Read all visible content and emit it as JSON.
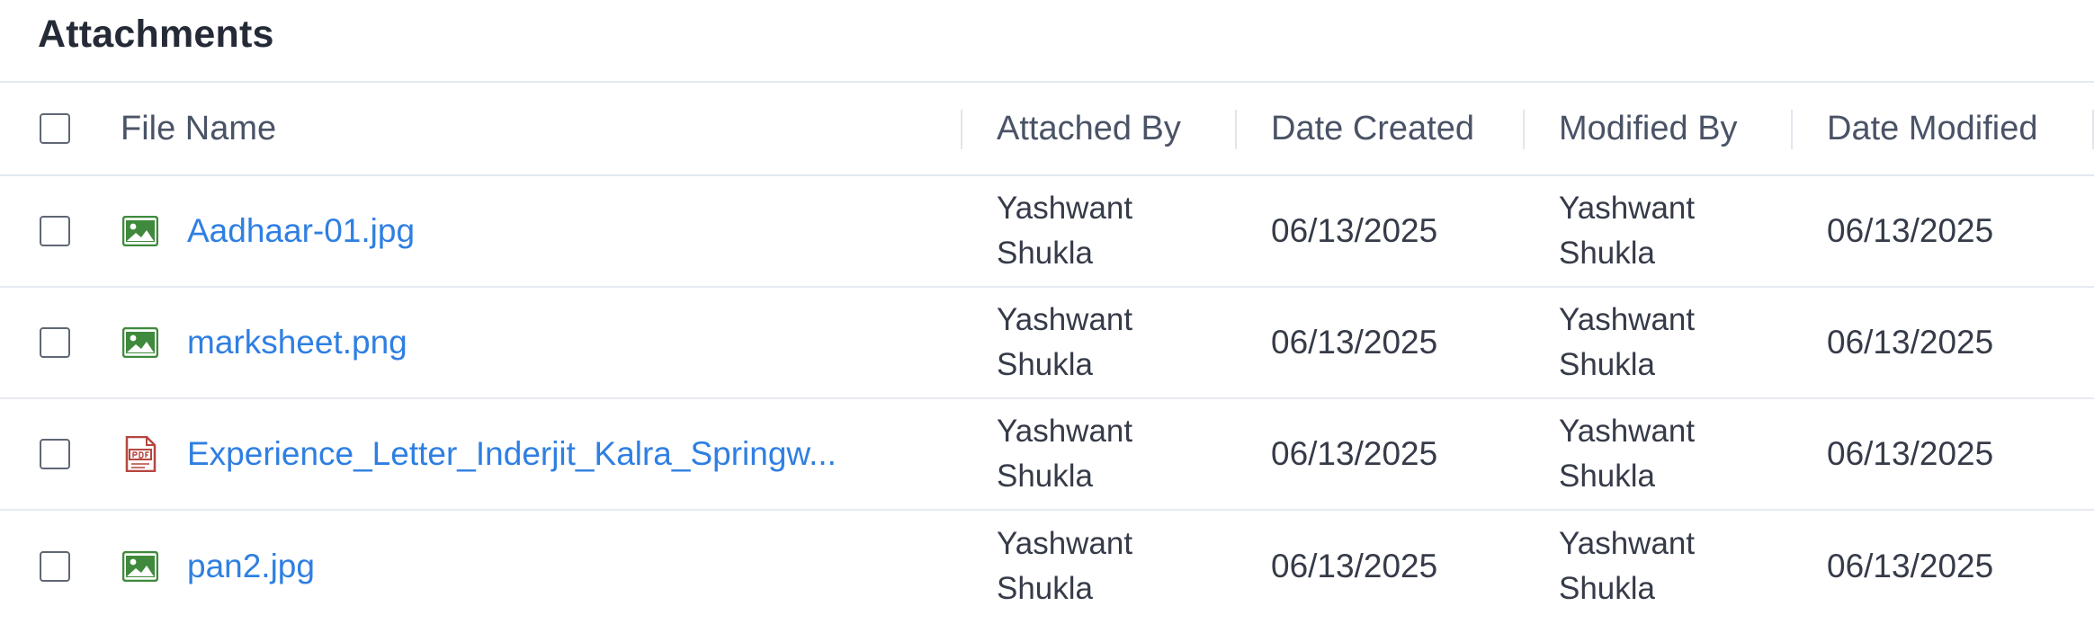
{
  "panel": {
    "title": "Attachments"
  },
  "columns": {
    "file_name": "File Name",
    "attached_by": "Attached By",
    "date_created": "Date Created",
    "modified_by": "Modified By",
    "date_modified": "Date Modified"
  },
  "rows": [
    {
      "icon": "image-file-icon",
      "file_name": "Aadhaar-01.jpg",
      "attached_by_first": "Yashwant",
      "attached_by_last": "Shukla",
      "date_created": "06/13/2025",
      "modified_by_first": "Yashwant",
      "modified_by_last": "Shukla",
      "date_modified": "06/13/2025"
    },
    {
      "icon": "image-file-icon",
      "file_name": "marksheet.png",
      "attached_by_first": "Yashwant",
      "attached_by_last": "Shukla",
      "date_created": "06/13/2025",
      "modified_by_first": "Yashwant",
      "modified_by_last": "Shukla",
      "date_modified": "06/13/2025"
    },
    {
      "icon": "pdf-file-icon",
      "file_name": "Experience_Letter_Inderjit_Kalra_Springw...",
      "attached_by_first": "Yashwant",
      "attached_by_last": "Shukla",
      "date_created": "06/13/2025",
      "modified_by_first": "Yashwant",
      "modified_by_last": "Shukla",
      "date_modified": "06/13/2025"
    },
    {
      "icon": "image-file-icon",
      "file_name": "pan2.jpg",
      "attached_by_first": "Yashwant",
      "attached_by_last": "Shukla",
      "date_created": "06/13/2025",
      "modified_by_first": "Yashwant",
      "modified_by_last": "Shukla",
      "date_modified": "06/13/2025"
    }
  ],
  "colors": {
    "link": "#2f7fe2",
    "image_icon": "#3f8a3c",
    "pdf_icon": "#b5473f",
    "divider": "#e3e8f1"
  }
}
